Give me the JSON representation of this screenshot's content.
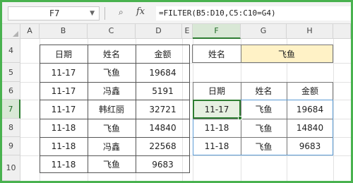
{
  "name_box": {
    "value": "F7"
  },
  "formula_bar": {
    "zoom_icon": "zoom-icon",
    "fx_label": "fx",
    "formula": "=FILTER(B5:D10,C5:C10=G4)"
  },
  "columns": [
    "A",
    "B",
    "C",
    "D",
    "E",
    "F",
    "G",
    "H"
  ],
  "rows": [
    "4",
    "5",
    "6",
    "7",
    "8",
    "9",
    "10"
  ],
  "active_cell": {
    "column": "F",
    "row": "7"
  },
  "source_table": {
    "headers": [
      "日期",
      "姓名",
      "金额"
    ],
    "rows": [
      [
        "11-17",
        "飞鱼",
        "19684"
      ],
      [
        "11-17",
        "冯鑫",
        "5191"
      ],
      [
        "11-17",
        "韩红丽",
        "32721"
      ],
      [
        "11-18",
        "飞鱼",
        "14840"
      ],
      [
        "11-18",
        "冯鑫",
        "22568"
      ],
      [
        "11-18",
        "飞鱼",
        "9683"
      ]
    ]
  },
  "criteria": {
    "label": "姓名",
    "value": "飞鱼"
  },
  "result_table": {
    "headers": [
      "日期",
      "姓名",
      "金额"
    ],
    "rows": [
      [
        "11-17",
        "飞鱼",
        "19684"
      ],
      [
        "11-18",
        "飞鱼",
        "14840"
      ],
      [
        "11-18",
        "飞鱼",
        "9683"
      ]
    ]
  },
  "colors": {
    "frame": "#49b24f",
    "criteria_fill": "#fff2c6",
    "selection": "#2e7d32",
    "spill_border": "#5b9bd5"
  }
}
